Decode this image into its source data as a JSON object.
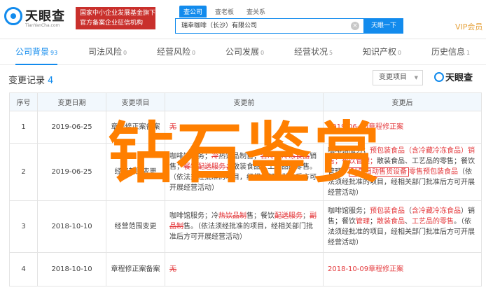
{
  "header": {
    "logo_text": "天眼查",
    "logo_sub": "TianYanCha.com",
    "badge_line1": "国家中小企业发展基金旗下",
    "badge_line2": "官方备案企业征信机构",
    "search_tabs": [
      "查公司",
      "查老板",
      "查关系"
    ],
    "search_value": "瑞幸咖啡（长沙）有限公司",
    "search_clear_icon": "×",
    "search_button": "天眼一下",
    "vip_label": "VIP会员"
  },
  "nav": {
    "tabs": [
      {
        "label": "公司背景",
        "count": "93"
      },
      {
        "label": "司法风险",
        "count": "0"
      },
      {
        "label": "经营风险",
        "count": "0"
      },
      {
        "label": "公司发展",
        "count": "0"
      },
      {
        "label": "经营状况",
        "count": "5"
      },
      {
        "label": "知识产权",
        "count": "0"
      },
      {
        "label": "历史信息",
        "count": "1"
      }
    ]
  },
  "section": {
    "title": "变更记录",
    "count": "4",
    "filter_label": "变更项目",
    "filter_arrow": "▼",
    "brand_text": "天眼查"
  },
  "table": {
    "headers": [
      "序号",
      "变更日期",
      "变更项目",
      "变更前",
      "变更后"
    ],
    "rows": [
      {
        "index": "1",
        "date": "2019-06-25",
        "item": "章程修正案备案",
        "before": "无",
        "after": "2019-06-20章程修正案"
      },
      {
        "index": "2",
        "date": "2019-06-25",
        "item": "经营范围变更",
        "before_parts": [
          "咖啡馆服务；",
          "冷",
          "热饮品制售；",
          "含冷藏冷冻食品",
          "销售；",
          "餐饮配送服务；",
          "散装食品、工艺品的零售。",
          "（依法须经批准的项目，经相关部门批准后方可开展经营活动）"
        ],
        "after_parts": [
          "咖啡馆服务；",
          "预包装食品（含冷藏冷冻食品）销售；",
          "餐饮管理；",
          "散装食品、工艺品的零售；",
          "餐饮管理；",
          "利用自动售货设备",
          "零售预包装食品",
          "（依法须经批准的项目，经相关部门批准后方可开展经营活动）"
        ]
      },
      {
        "index": "3",
        "date": "2018-10-10",
        "item": "经营范围变更",
        "before_parts": [
          "咖啡馆服务；冷",
          "热饮品",
          "制",
          "售；餐饮",
          "配送服务",
          "；",
          "副品",
          "制",
          "售。（依法须经批准的项目，经相关部门批准后方可开展经营活动）"
        ],
        "after_parts": [
          "咖啡馆服务；",
          "预包装食品",
          "（",
          "含冷藏冷冻食品",
          "）",
          "销售；餐饮",
          "管理",
          "；",
          "散装食品",
          "、",
          "工艺品的零售",
          "。（依法须经批准的项目，经相关部门批准后方可开展经营活动）"
        ]
      },
      {
        "index": "4",
        "date": "2018-10-10",
        "item": "章程修正案备案",
        "before": "无",
        "after": "2018-10-09章程修正案"
      }
    ]
  },
  "watermark": "钻石鉴赏",
  "colors": {
    "accent": "#128bed",
    "badge": "#c9302c",
    "change": "#e4393c",
    "watermark": "#ff7f00",
    "vip": "#e6a23c"
  },
  "icons": {
    "logo": "eye-logo-icon",
    "search_clear": "clear-icon",
    "filter": "chevron-down-icon"
  }
}
